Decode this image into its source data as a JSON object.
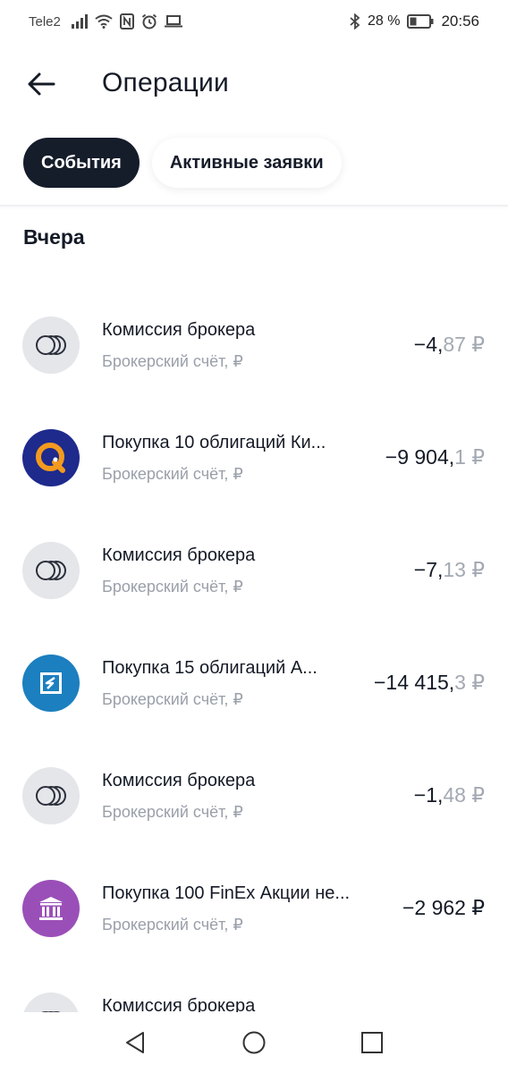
{
  "status_bar": {
    "carrier": "Tele2",
    "battery": "28 %",
    "time": "20:56",
    "icons": [
      "signal-icon",
      "wifi-icon",
      "nfc-icon",
      "alarm-icon",
      "laptop-icon",
      "bluetooth-icon",
      "battery-icon"
    ]
  },
  "header": {
    "back_icon": "arrow-left-icon",
    "title": "Операции"
  },
  "tabs": [
    {
      "label": "События",
      "active": true
    },
    {
      "label": "Активные заявки",
      "active": false
    }
  ],
  "section": {
    "title": "Вчера"
  },
  "operations": [
    {
      "icon": "coins-icon",
      "title": "Комиссия брокера",
      "subtitle": "Брокерский счёт, ₽",
      "amount_int": "−4,",
      "amount_dec": "87 ₽",
      "icon_bg": "#e4e6ea"
    },
    {
      "icon": "qiwi-logo-icon",
      "title": "Покупка 10 облигаций Ки...",
      "subtitle": "Брокерский счёт, ₽",
      "amount_int": "−9 904,",
      "amount_dec": "1 ₽",
      "icon_bg": "#1e2a8c"
    },
    {
      "icon": "coins-icon",
      "title": "Комиссия брокера",
      "subtitle": "Брокерский счёт, ₽",
      "amount_int": "−7,",
      "amount_dec": "13 ₽",
      "icon_bg": "#e4e6ea"
    },
    {
      "icon": "bank-logo-icon",
      "title": "Покупка 15 облигаций А...",
      "subtitle": "Брокерский счёт, ₽",
      "amount_int": "−14 415,",
      "amount_dec": "3 ₽",
      "icon_bg": "#1c7fbf"
    },
    {
      "icon": "coins-icon",
      "title": "Комиссия брокера",
      "subtitle": "Брокерский счёт, ₽",
      "amount_int": "−1,",
      "amount_dec": "48 ₽",
      "icon_bg": "#e4e6ea"
    },
    {
      "icon": "finex-logo-icon",
      "title": "Покупка 100 FinEx Акции не...",
      "subtitle": "Брокерский счёт, ₽",
      "amount_int": "−2 962 ₽",
      "amount_dec": "",
      "icon_bg": "#9a4fb8"
    },
    {
      "icon": "coins-icon",
      "title": "Комиссия брокера",
      "subtitle": "",
      "amount_int": "",
      "amount_dec": "",
      "icon_bg": "#e4e6ea"
    }
  ],
  "navbar": {
    "back": "nav-back-icon",
    "home": "nav-home-icon",
    "recent": "nav-recent-icon"
  },
  "colors": {
    "accent_dark": "#151c2a",
    "muted": "#9aa0aa",
    "background": "#ffffff"
  }
}
